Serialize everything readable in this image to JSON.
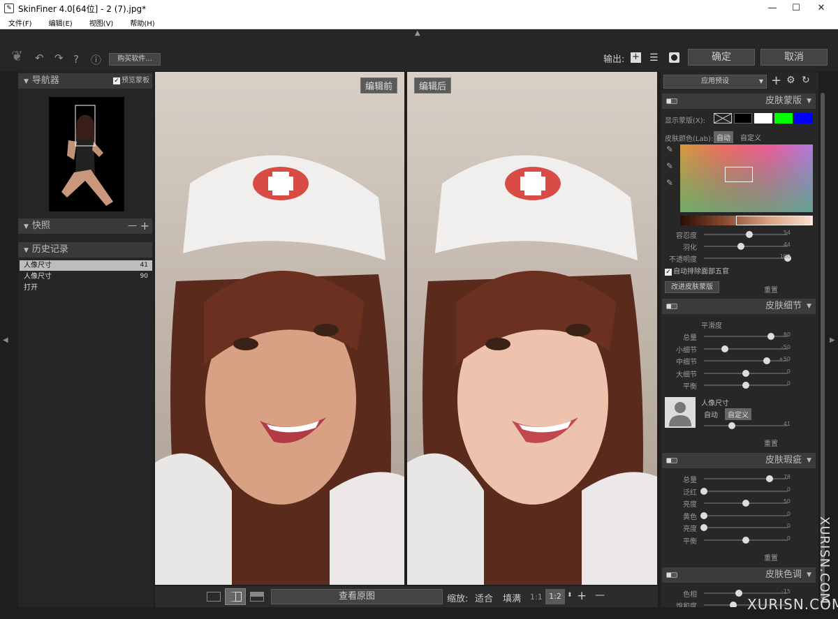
{
  "window": {
    "title": "SkinFiner 4.0[64位] - 2 (7).jpg*",
    "minimize": "—",
    "maximize": "☐",
    "close": "✕"
  },
  "menu": [
    "文件(F)",
    "编辑(E)",
    "视图(V)",
    "帮助(H)"
  ],
  "toolbar": {
    "buy": "购买软件...",
    "output_label": "输出:",
    "ok": "确定",
    "cancel": "取消",
    "undo_icon": "↶",
    "redo_icon": "↷",
    "help": "?",
    "info": "ⓘ"
  },
  "navigator": {
    "title": "导航器",
    "preview_mask": "预览蒙板"
  },
  "snapshot": {
    "title": "快照",
    "minus": "—",
    "plus": "+"
  },
  "history": {
    "title": "历史记录",
    "items": [
      {
        "label": "人像尺寸",
        "value": "41"
      },
      {
        "label": "人像尺寸",
        "value": "90"
      },
      {
        "label": "打开",
        "value": ""
      }
    ]
  },
  "canvas": {
    "before": "编辑前",
    "after": "编辑后"
  },
  "bottom": {
    "view_original": "查看原图",
    "zoom": "缩放:",
    "fit": "适合",
    "fill": "填满",
    "one_to_one": "1:1",
    "ratio": "1:2",
    "plus": "+",
    "minus": "—"
  },
  "right": {
    "preset": "应用预设",
    "skin_mask": {
      "title": "皮肤蒙版",
      "show_mask": "显示蒙版(X):",
      "skin_color": "皮肤颜色(Lab):",
      "auto": "自动",
      "custom": "自定义",
      "sliders": [
        {
          "label": "容忍度",
          "value": "54",
          "pct": 0.54
        },
        {
          "label": "羽化",
          "value": "44",
          "pct": 0.44
        },
        {
          "label": "不透明度",
          "value": "100",
          "pct": 1.0
        }
      ],
      "exclude": "自动排除面部五官",
      "improve": "改进皮肤蒙版",
      "reset": "重置"
    },
    "skin_detail": {
      "title": "皮肤细节",
      "smooth": "平滑度",
      "sliders": [
        {
          "label": "总量",
          "value": "80",
          "pct": 0.8
        },
        {
          "label": "小细节",
          "value": "-50",
          "pct": 0.25
        },
        {
          "label": "中细节",
          "value": "+50",
          "pct": 0.75
        },
        {
          "label": "大细节",
          "value": "0",
          "pct": 0.5
        },
        {
          "label": "平衡",
          "value": "0",
          "pct": 0.5
        }
      ],
      "portrait": "人像尺寸",
      "auto": "自动",
      "custom": "自定义",
      "portrait_value": "41",
      "portrait_pct": 0.33,
      "reset": "重置"
    },
    "blemish": {
      "title": "皮肤瑕疵",
      "sliders": [
        {
          "label": "总量",
          "value": "78",
          "pct": 0.78
        },
        {
          "label": "泛红",
          "value": "0",
          "pct": 0.0
        },
        {
          "label": "亮度",
          "value": "50",
          "pct": 0.5
        },
        {
          "label": "黄色",
          "value": "0",
          "pct": 0.0
        },
        {
          "label": "亮度",
          "value": "0",
          "pct": 0.0
        },
        {
          "label": "平衡",
          "value": "0",
          "pct": 0.5
        }
      ],
      "reset": "重置"
    },
    "tone": {
      "title": "皮肤色调",
      "sliders": [
        {
          "label": "色相",
          "value": "-15",
          "pct": 0.42
        },
        {
          "label": "饱和度",
          "value": "",
          "pct": 0.35
        }
      ]
    }
  },
  "watermark": "XURISN.COM",
  "colors": {
    "accent": "#555555",
    "green": "#00ff00",
    "blue": "#0000ff"
  }
}
